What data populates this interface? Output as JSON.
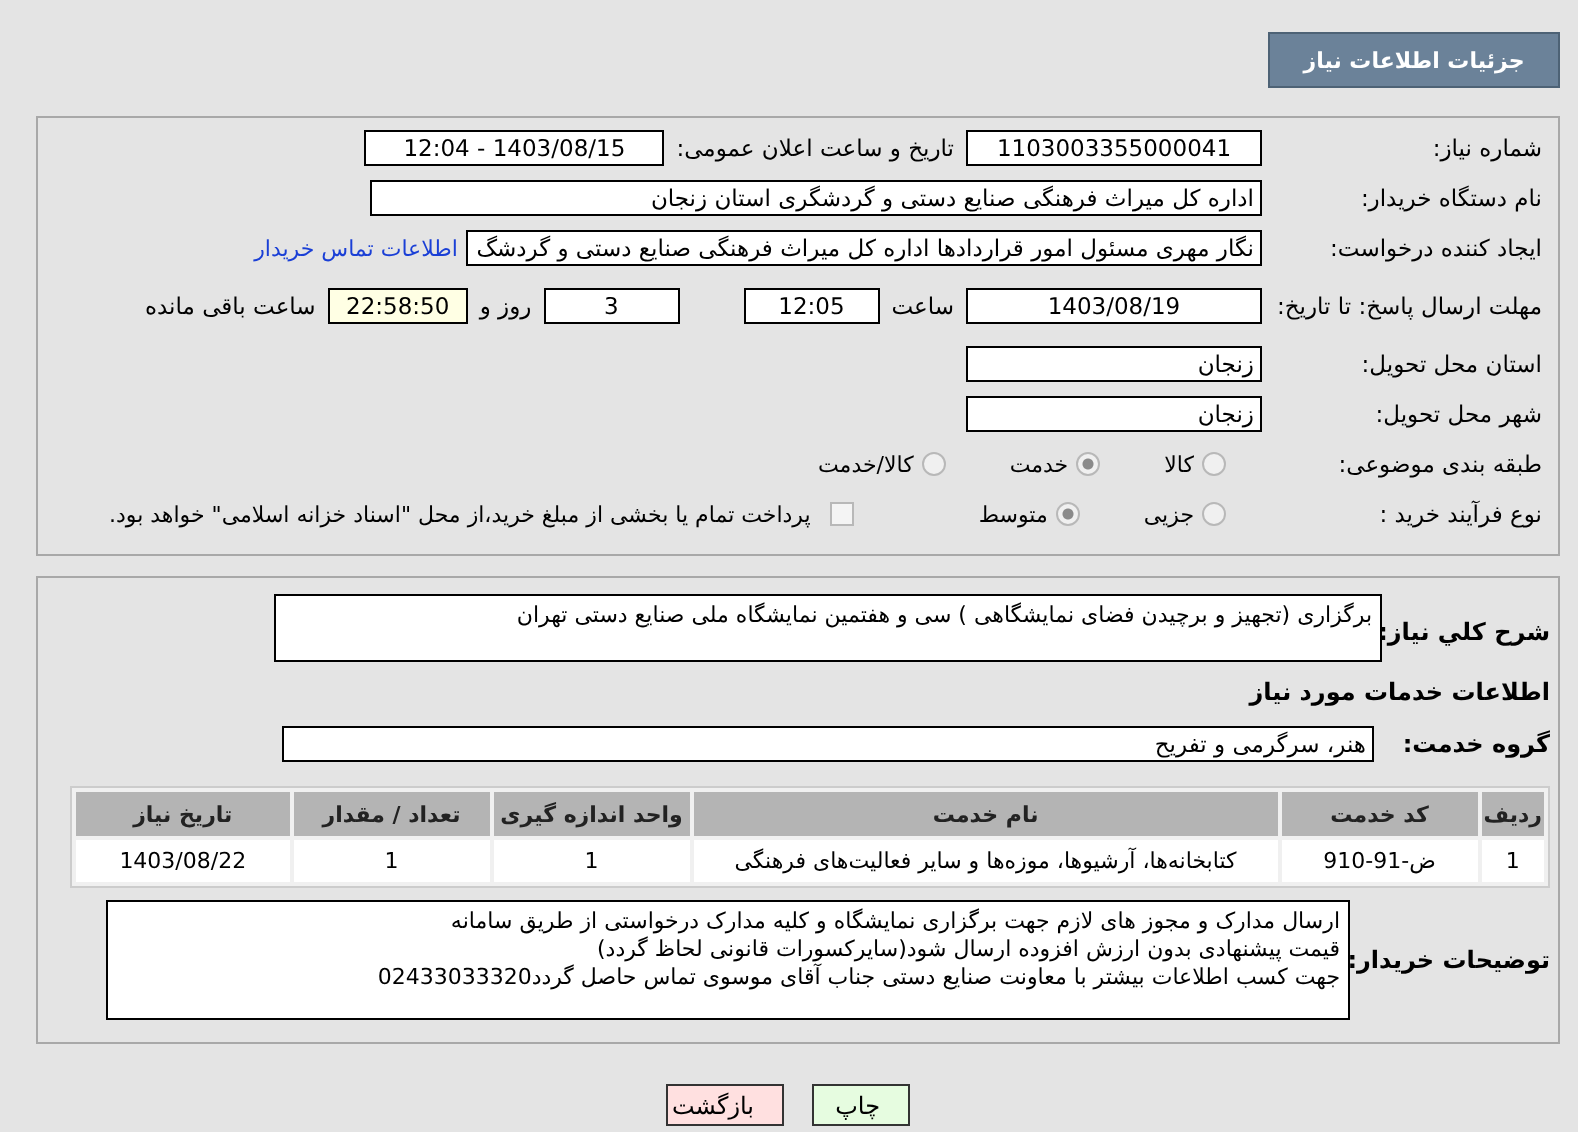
{
  "header": {
    "title": "جزئیات اطلاعات نیاز"
  },
  "details": {
    "need_number": {
      "label": "شماره نیاز:",
      "value": "1103003355000041"
    },
    "announce": {
      "label": "تاریخ و ساعت اعلان عمومی:",
      "value": "1403/08/15 - 12:04"
    },
    "buyer": {
      "label": "نام دستگاه خریدار:",
      "value": "اداره کل میراث فرهنگی  صنایع دستی و گردشگری استان زنجان"
    },
    "creator": {
      "label": "ایجاد کننده درخواست:",
      "value": "نگار مهری مسئول امور قراردادها اداره کل میراث فرهنگی  صنایع دستی و گردشگ",
      "link": "اطلاعات تماس خریدار"
    },
    "deadline": {
      "label": "مهلت ارسال پاسخ: تا تاریخ:",
      "date": "1403/08/19",
      "time_label": "ساعت",
      "time": "12:05",
      "days": "3",
      "days_label": "روز و",
      "remaining": "22:58:50",
      "remaining_label": "ساعت باقی مانده"
    },
    "province": {
      "label": "استان محل تحویل:",
      "value": "زنجان"
    },
    "city": {
      "label": "شهر محل تحویل:",
      "value": "زنجان"
    },
    "category": {
      "label": "طبقه بندی موضوعی:",
      "options": [
        {
          "label": "کالا",
          "selected": false
        },
        {
          "label": "خدمت",
          "selected": true
        },
        {
          "label": "کالا/خدمت",
          "selected": false
        }
      ]
    },
    "process": {
      "label": "نوع فرآیند خرید :",
      "options": [
        {
          "label": "جزیی",
          "selected": false
        },
        {
          "label": "متوسط",
          "selected": true
        }
      ],
      "payment": {
        "checked": false,
        "text": "پرداخت تمام یا بخشی از مبلغ خرید،از محل \"اسناد خزانه اسلامی\" خواهد بود."
      }
    }
  },
  "services": {
    "summary": {
      "label": "شرح کلي نياز:",
      "value": "برگزاری (تجهیز و برچیدن فضای نمایشگاهی ) سی و هفتمین نمایشگاه ملی صنایع دستی تهران"
    },
    "heading": "اطلاعات خدمات مورد نیاز",
    "group": {
      "label": "گروه خدمت:",
      "value": "هنر، سرگرمی و تفریح"
    },
    "table": {
      "columns": [
        "ردیف",
        "کد خدمت",
        "نام خدمت",
        "واحد اندازه گیری",
        "تعداد / مقدار",
        "تاریخ نیاز"
      ],
      "rows": [
        [
          "1",
          "ض-91-910",
          "کتابخانه‌ها، آرشیوها، موزه‌ها و سایر فعالیت‌های فرهنگی",
          "1",
          "1",
          "1403/08/22"
        ]
      ]
    },
    "notes": {
      "label": "توضیحات خریدار:",
      "lines": [
        "ارسال مدارک و مجوز های لازم جهت برگزاری نمایشگاه و کلیه مدارک درخواستی از طریق سامانه",
        "قیمت پیشنهادی بدون ارزش افزوده ارسال شود(سایرکسورات قانونی لحاظ گردد)",
        "جهت کسب اطلاعات بیشتر با معاونت صنایع دستی جناب آقای موسوی تماس حاصل گردد02433033320"
      ]
    }
  },
  "buttons": [
    {
      "label": "چاپ",
      "kind": "print"
    },
    {
      "label": "بازگشت",
      "kind": "back"
    }
  ]
}
